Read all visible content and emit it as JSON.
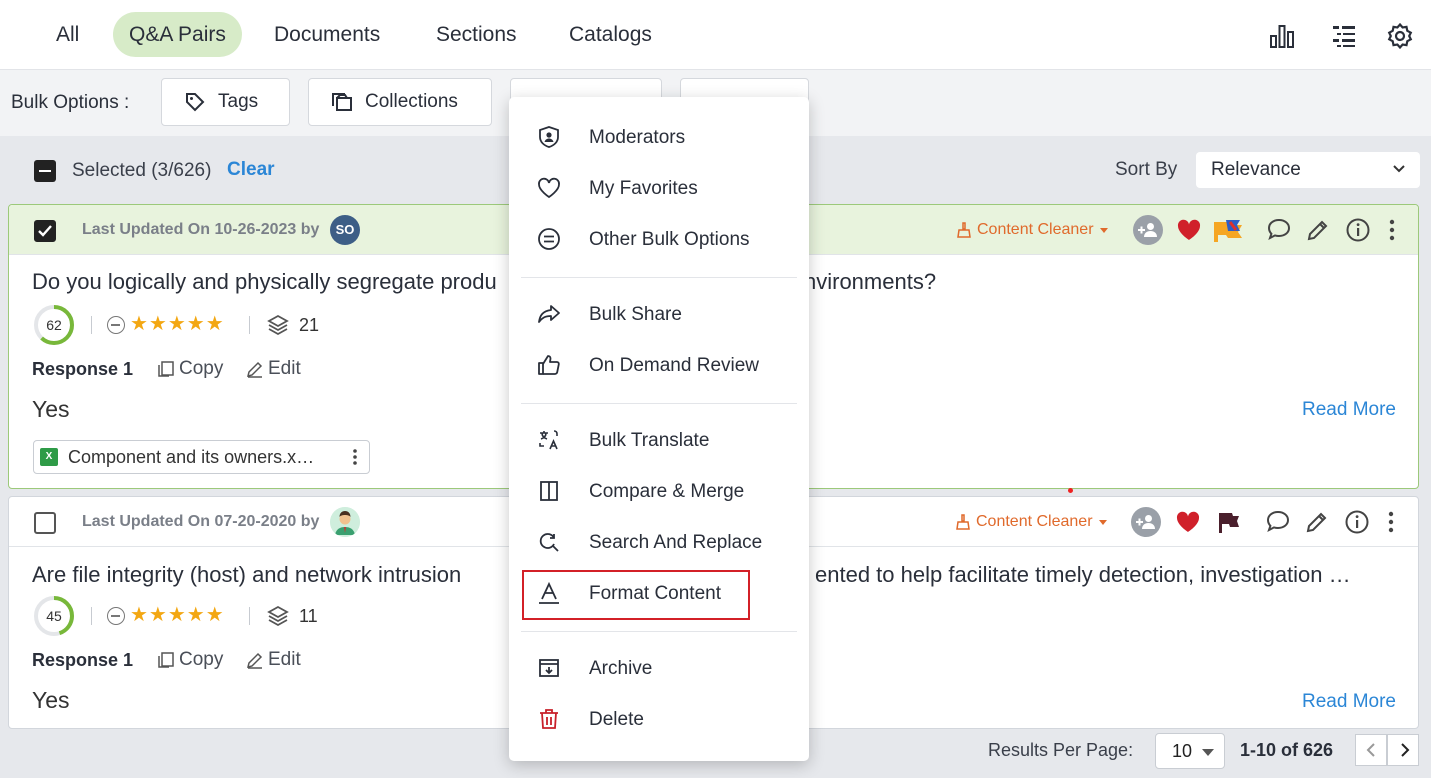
{
  "tabs": [
    {
      "label": "All"
    },
    {
      "label": "Q&A Pairs",
      "active": true
    },
    {
      "label": "Documents"
    },
    {
      "label": "Sections"
    },
    {
      "label": "Catalogs"
    }
  ],
  "top_icons": [
    "bar-chart-icon",
    "list-icon",
    "gear-icon"
  ],
  "bulk": {
    "label": "Bulk Options :",
    "tags": "Tags",
    "collections": "Collections"
  },
  "selection": {
    "text": "Selected (3/626)",
    "clear": "Clear",
    "sort_label": "Sort By",
    "sort_value": "Relevance"
  },
  "cards": [
    {
      "checked": true,
      "updated": "Last Updated On 10-26-2023 by",
      "avatar": "SO",
      "cleaner": "Content Cleaner",
      "question": "Do you logically and physically segregate produ",
      "question_tail": "nvironments?",
      "score": "62",
      "score_fraction": 0.62,
      "rating": "★★★★★",
      "layers": "21",
      "response": "Response 1",
      "copy": "Copy",
      "edit": "Edit",
      "answer": "Yes",
      "read_more": "Read More",
      "attachment": "Component and its owners.x…"
    },
    {
      "checked": false,
      "updated": "Last Updated On 07-20-2020 by",
      "cleaner": "Content Cleaner",
      "question": "Are file integrity (host) and network intrusion",
      "question_tail": "ented to help facilitate timely detection, investigation …",
      "score": "45",
      "score_fraction": 0.45,
      "rating": "★★★★★",
      "layers": "11",
      "response": "Response 1",
      "copy": "Copy",
      "edit": "Edit",
      "answer": "Yes",
      "read_more": "Read More"
    }
  ],
  "pagination": {
    "label": "Results Per Page:",
    "per_page": "10",
    "range": "1-10 of 626"
  },
  "menu": {
    "items": [
      {
        "label": "Moderators",
        "icon": "shield-user-icon"
      },
      {
        "label": "My Favorites",
        "icon": "heart-icon"
      },
      {
        "label": "Other Bulk Options",
        "icon": "menu-circle-icon"
      },
      {
        "label": "Bulk Share",
        "icon": "share-arrow-icon"
      },
      {
        "label": "On Demand Review",
        "icon": "thumbs-up-icon"
      },
      {
        "label": "Bulk Translate",
        "icon": "translate-icon"
      },
      {
        "label": "Compare & Merge",
        "icon": "split-panel-icon"
      },
      {
        "label": "Search And Replace",
        "icon": "search-replace-icon"
      },
      {
        "label": "Format Content",
        "icon": "format-text-icon",
        "highlighted": true
      },
      {
        "label": "Archive",
        "icon": "archive-icon"
      },
      {
        "label": "Delete",
        "icon": "trash-icon"
      }
    ]
  },
  "colors": {
    "accent_blue": "#2b86d6",
    "active_tab": "#d7ebc8",
    "selected_card": "#e8f3dd",
    "cleaner": "#e06a2c",
    "heart": "#d0202a",
    "delete": "#c8202a",
    "highlight_border": "#d32027"
  }
}
